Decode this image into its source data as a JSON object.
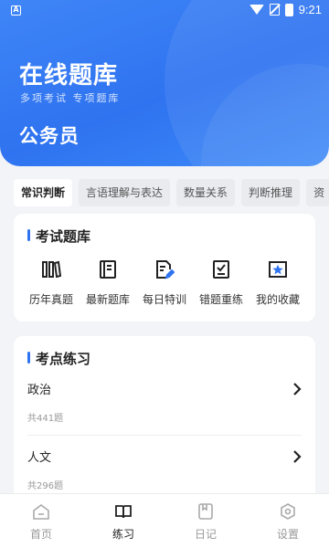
{
  "status_bar": {
    "app_icon": "A",
    "time": "9:21"
  },
  "header": {
    "title": "在线题库",
    "subtitle": "多项考试 专项题库",
    "exam": "公务员"
  },
  "categories": [
    {
      "label": "常识判断",
      "active": true
    },
    {
      "label": "言语理解与表达",
      "active": false
    },
    {
      "label": "数量关系",
      "active": false
    },
    {
      "label": "判断推理",
      "active": false
    },
    {
      "label": "资",
      "active": false
    }
  ],
  "question_bank": {
    "title": "考试题库",
    "items": [
      {
        "label": "历年真题",
        "icon": "books-icon"
      },
      {
        "label": "最新题库",
        "icon": "notebook-icon"
      },
      {
        "label": "每日特训",
        "icon": "edit-document-icon"
      },
      {
        "label": "错题重练",
        "icon": "checklist-icon"
      },
      {
        "label": "我的收藏",
        "icon": "star-folder-icon"
      }
    ]
  },
  "practice": {
    "title": "考点练习",
    "topics": [
      {
        "name": "政治",
        "count": "共441题"
      },
      {
        "name": "人文",
        "count": "共296题"
      }
    ]
  },
  "bottom_nav": [
    {
      "label": "首页",
      "icon": "home-icon",
      "active": false
    },
    {
      "label": "练习",
      "icon": "book-open-icon",
      "active": true
    },
    {
      "label": "日记",
      "icon": "diary-icon",
      "active": false
    },
    {
      "label": "设置",
      "icon": "settings-icon",
      "active": false
    }
  ],
  "colors": {
    "primary": "#2f73f0",
    "background": "#f2f4f7"
  }
}
